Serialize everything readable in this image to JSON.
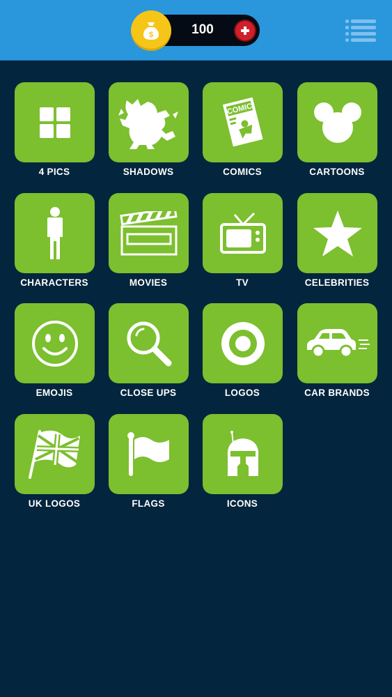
{
  "header": {
    "coins": "100",
    "icons": {
      "coin": "money-bag-icon",
      "add": "plus-icon",
      "menu": "menu-icon"
    }
  },
  "categories": [
    {
      "label": "4 PICS",
      "icon": "four-squares-icon"
    },
    {
      "label": "SHADOWS",
      "icon": "taz-silhouette-icon"
    },
    {
      "label": "COMICS",
      "icon": "comic-book-icon"
    },
    {
      "label": "CARTOONS",
      "icon": "mouse-ears-icon"
    },
    {
      "label": "CHARACTERS",
      "icon": "person-icon"
    },
    {
      "label": "MOVIES",
      "icon": "clapperboard-icon"
    },
    {
      "label": "TV",
      "icon": "television-icon"
    },
    {
      "label": "CELEBRITIES",
      "icon": "star-icon"
    },
    {
      "label": "EMOJIS",
      "icon": "smiley-icon"
    },
    {
      "label": "CLOSE UPS",
      "icon": "magnifier-icon"
    },
    {
      "label": "LOGOS",
      "icon": "target-icon"
    },
    {
      "label": "CAR BRANDS",
      "icon": "car-icon"
    },
    {
      "label": "UK LOGOS",
      "icon": "union-flag-icon"
    },
    {
      "label": "FLAGS",
      "icon": "flag-icon"
    },
    {
      "label": "ICONS",
      "icon": "helmet-icon"
    }
  ],
  "colors": {
    "background": "#03253d",
    "header": "#2a96dc",
    "tile": "#7cbf2f",
    "coin": "#f5c518",
    "plus": "#d0202a"
  }
}
